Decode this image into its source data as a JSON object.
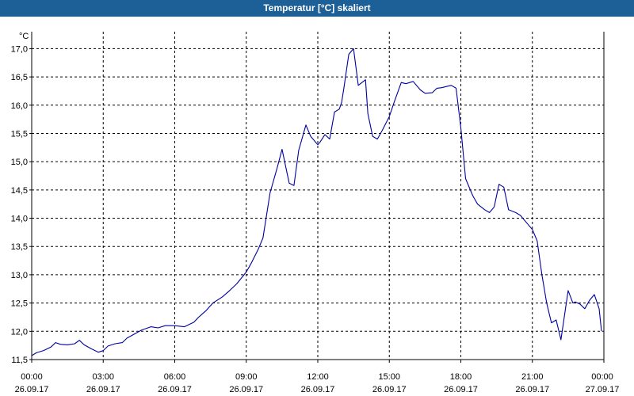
{
  "window": {
    "title": "Temperatur [°C] skaliert"
  },
  "chart_data": {
    "type": "line",
    "title": "Temperatur [°C] skaliert",
    "ylabel": "°C",
    "xlabel": "",
    "ylim": [
      11.5,
      17.3
    ],
    "xlim": [
      0,
      24
    ],
    "grid": true,
    "y_ticks": [
      {
        "v": 17.0,
        "label": "17,0"
      },
      {
        "v": 16.5,
        "label": "16,5"
      },
      {
        "v": 16.0,
        "label": "16,0"
      },
      {
        "v": 15.5,
        "label": "15,5"
      },
      {
        "v": 15.0,
        "label": "15,0"
      },
      {
        "v": 14.5,
        "label": "14,5"
      },
      {
        "v": 14.0,
        "label": "14,0"
      },
      {
        "v": 13.5,
        "label": "13,5"
      },
      {
        "v": 13.0,
        "label": "13,0"
      },
      {
        "v": 12.5,
        "label": "12,5"
      },
      {
        "v": 12.0,
        "label": "12,0"
      },
      {
        "v": 11.5,
        "label": "11,5"
      }
    ],
    "x_ticks": [
      {
        "v": 0,
        "time": "00:00",
        "date": "26.09.17"
      },
      {
        "v": 3,
        "time": "03:00",
        "date": "26.09.17"
      },
      {
        "v": 6,
        "time": "06:00",
        "date": "26.09.17"
      },
      {
        "v": 9,
        "time": "09:00",
        "date": "26.09.17"
      },
      {
        "v": 12,
        "time": "12:00",
        "date": "26.09.17"
      },
      {
        "v": 15,
        "time": "15:00",
        "date": "26.09.17"
      },
      {
        "v": 18,
        "time": "18:00",
        "date": "26.09.17"
      },
      {
        "v": 21,
        "time": "21:00",
        "date": "26.09.17"
      },
      {
        "v": 24,
        "time": "00:00",
        "date": "27.09.17"
      }
    ],
    "series": [
      {
        "color": "#0000a0",
        "x": [
          0.0,
          0.2,
          0.5,
          0.8,
          1.0,
          1.2,
          1.5,
          1.8,
          2.0,
          2.2,
          2.5,
          2.8,
          3.0,
          3.2,
          3.5,
          3.8,
          4.0,
          4.3,
          4.6,
          5.0,
          5.3,
          5.6,
          6.0,
          6.4,
          6.8,
          7.0,
          7.3,
          7.6,
          8.0,
          8.3,
          8.6,
          9.0,
          9.2,
          9.5,
          9.7,
          10.0,
          10.3,
          10.5,
          10.8,
          11.0,
          11.2,
          11.5,
          11.7,
          12.0,
          12.1,
          12.3,
          12.5,
          12.7,
          12.9,
          13.0,
          13.1,
          13.3,
          13.5,
          13.7,
          14.0,
          14.1,
          14.3,
          14.5,
          14.7,
          15.0,
          15.2,
          15.5,
          15.7,
          16.0,
          16.3,
          16.5,
          16.8,
          17.0,
          17.2,
          17.4,
          17.6,
          17.8,
          18.0,
          18.2,
          18.5,
          18.7,
          19.0,
          19.2,
          19.4,
          19.6,
          19.8,
          20.0,
          20.3,
          20.5,
          20.8,
          21.0,
          21.2,
          21.4,
          21.6,
          21.8,
          22.0,
          22.2,
          22.5,
          22.7,
          22.8,
          23.0,
          23.2,
          23.4,
          23.6,
          23.8,
          23.9
        ],
        "y": [
          11.57,
          11.62,
          11.66,
          11.72,
          11.8,
          11.77,
          11.76,
          11.78,
          11.84,
          11.76,
          11.69,
          11.63,
          11.66,
          11.74,
          11.78,
          11.8,
          11.88,
          11.95,
          12.02,
          12.08,
          12.06,
          12.1,
          12.1,
          12.08,
          12.16,
          12.25,
          12.36,
          12.5,
          12.61,
          12.72,
          12.84,
          13.05,
          13.2,
          13.45,
          13.65,
          14.45,
          14.9,
          15.22,
          14.62,
          14.58,
          15.2,
          15.65,
          15.45,
          15.3,
          15.35,
          15.48,
          15.4,
          15.88,
          15.93,
          16.05,
          16.32,
          16.9,
          17.0,
          16.35,
          16.45,
          15.85,
          15.45,
          15.4,
          15.55,
          15.8,
          16.05,
          16.4,
          16.38,
          16.42,
          16.27,
          16.21,
          16.22,
          16.3,
          16.31,
          16.33,
          16.35,
          16.3,
          15.6,
          14.7,
          14.4,
          14.25,
          14.15,
          14.1,
          14.2,
          14.6,
          14.55,
          14.15,
          14.1,
          14.05,
          13.9,
          13.8,
          13.6,
          13.0,
          12.5,
          12.15,
          12.2,
          11.85,
          12.72,
          12.5,
          12.52,
          12.48,
          12.4,
          12.55,
          12.65,
          12.4,
          12.0
        ]
      }
    ]
  }
}
